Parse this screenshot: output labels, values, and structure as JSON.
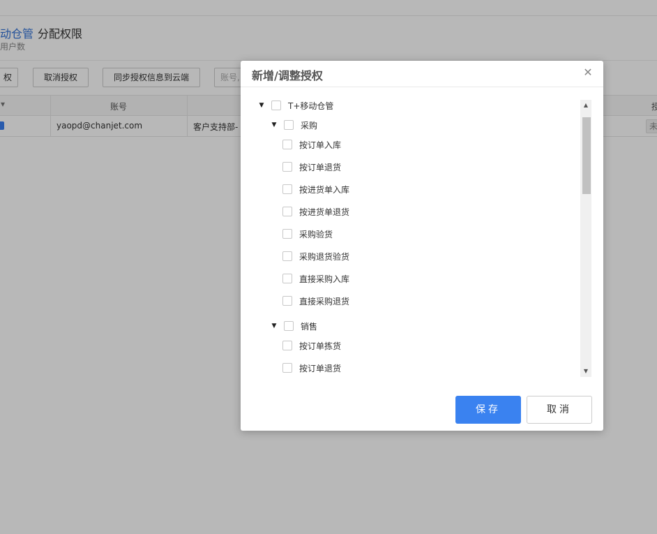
{
  "page": {
    "breadcrumb_link": "动仓管",
    "breadcrumb_current": "分配权限",
    "subtitle": "用户数",
    "buttons": {
      "authorize_partial": "权",
      "cancel_authorize": "取消授权",
      "sync_to_cloud": "同步授权信息到云端"
    },
    "search_placeholder": "账号,",
    "table": {
      "headers": {
        "account": "账号",
        "right_partial": "授"
      },
      "row": {
        "account": "yaopd@chanjet.com",
        "department": "客户支持部-",
        "status_partial": "未"
      }
    }
  },
  "modal": {
    "title": "新增/调整授权",
    "tree": [
      {
        "label": "T+移动仓管",
        "level": 0,
        "expanded": true,
        "has_caret": true
      },
      {
        "label": "采购",
        "level": 1,
        "expanded": true,
        "has_caret": true
      },
      {
        "label": "按订单入库",
        "level": 2
      },
      {
        "label": "按订单退货",
        "level": 2
      },
      {
        "label": "按进货单入库",
        "level": 2
      },
      {
        "label": "按进货单退货",
        "level": 2
      },
      {
        "label": "采购验货",
        "level": 2
      },
      {
        "label": "采购退货验货",
        "level": 2
      },
      {
        "label": "直接采购入库",
        "level": 2
      },
      {
        "label": "直接采购退货",
        "level": 2
      },
      {
        "label": "销售",
        "level": 1,
        "expanded": true,
        "has_caret": true
      },
      {
        "label": "按订单拣货",
        "level": 2
      },
      {
        "label": "按订单退货",
        "level": 2
      }
    ],
    "save_label": "保存",
    "cancel_label": "取消"
  },
  "icons": {
    "close": "close-icon",
    "caret": "caret-down-icon",
    "scroll_up": "scroll-up-icon",
    "scroll_down": "scroll-down-icon"
  },
  "colors": {
    "primary": "#3a82f0",
    "link": "#2f6fd6"
  }
}
